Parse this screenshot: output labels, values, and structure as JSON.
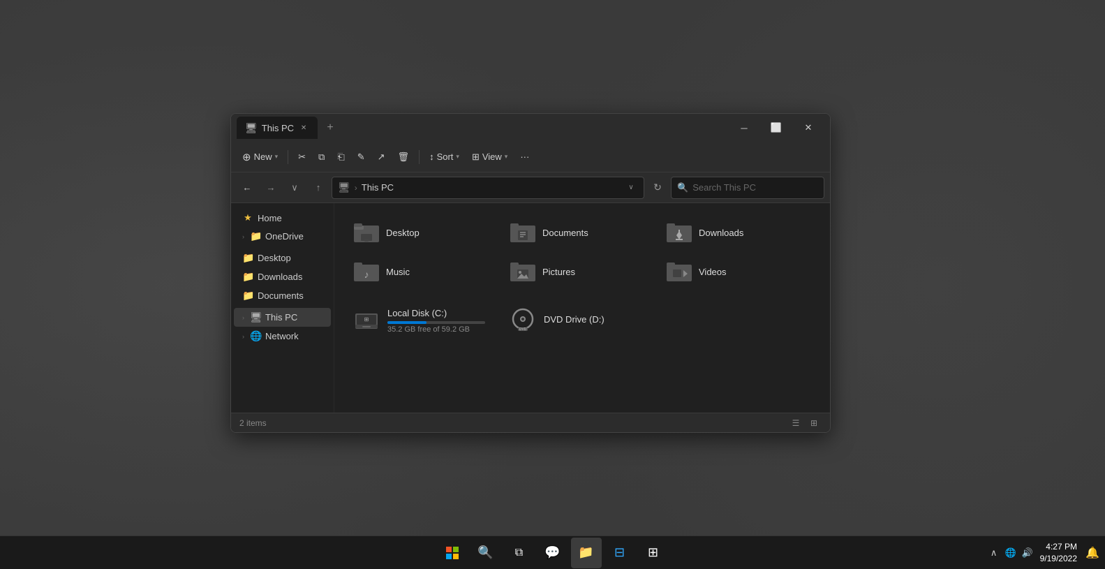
{
  "window": {
    "title": "This PC",
    "tab_label": "This PC",
    "tab_icon": "🖥"
  },
  "toolbar": {
    "new_label": "New",
    "cut_icon": "✂",
    "copy_icon": "⧉",
    "paste_icon": "📋",
    "rename_icon": "✏",
    "share_icon": "↗",
    "delete_icon": "🗑",
    "sort_label": "Sort",
    "view_label": "View",
    "more_icon": "···"
  },
  "addressbar": {
    "back_icon": "←",
    "forward_icon": "→",
    "recent_icon": "∨",
    "up_icon": "↑",
    "path_icon": "🖥",
    "path_location": "This PC",
    "chevron_icon": "∨",
    "refresh_icon": "↻",
    "search_placeholder": "Search This PC"
  },
  "sidebar": {
    "items": [
      {
        "id": "home",
        "label": "Home",
        "icon": "★",
        "type": "star"
      },
      {
        "id": "onedrive",
        "label": "OneDrive",
        "icon": "☁",
        "chevron": "›"
      },
      {
        "id": "desktop",
        "label": "Desktop",
        "icon": "📁"
      },
      {
        "id": "downloads",
        "label": "Downloads",
        "icon": "📁"
      },
      {
        "id": "documents",
        "label": "Documents",
        "icon": "📁"
      },
      {
        "id": "this-pc",
        "label": "This PC",
        "icon": "🖥",
        "chevron": "›",
        "active": true
      },
      {
        "id": "network",
        "label": "Network",
        "icon": "🌐",
        "chevron": "›"
      }
    ]
  },
  "folders": [
    {
      "id": "desktop",
      "name": "Desktop",
      "overlay": "🖥"
    },
    {
      "id": "documents",
      "name": "Documents",
      "overlay": "📄"
    },
    {
      "id": "downloads",
      "name": "Downloads",
      "overlay": "⬇"
    },
    {
      "id": "music",
      "name": "Music",
      "overlay": "🎵"
    },
    {
      "id": "pictures",
      "name": "Pictures",
      "overlay": "🖼"
    },
    {
      "id": "videos",
      "name": "Videos",
      "overlay": "🎬"
    }
  ],
  "drives": [
    {
      "id": "c-drive",
      "name": "Local Disk (C:)",
      "free": "35.2 GB free of 59.2 GB",
      "fill_percent": 40,
      "type": "drive"
    },
    {
      "id": "d-drive",
      "name": "DVD Drive (D:)",
      "type": "dvd"
    }
  ],
  "statusbar": {
    "items_count": "2 items"
  },
  "taskbar": {
    "time": "4:27 PM",
    "date": "9/19/2022",
    "apps": [
      {
        "id": "start",
        "type": "start"
      },
      {
        "id": "search",
        "icon": "🔍"
      },
      {
        "id": "task-view",
        "icon": "⊞"
      },
      {
        "id": "teams",
        "icon": "💜"
      },
      {
        "id": "explorer",
        "icon": "📁",
        "active": true
      },
      {
        "id": "widget",
        "icon": "⬜"
      },
      {
        "id": "xbox",
        "icon": "⊞"
      }
    ]
  }
}
